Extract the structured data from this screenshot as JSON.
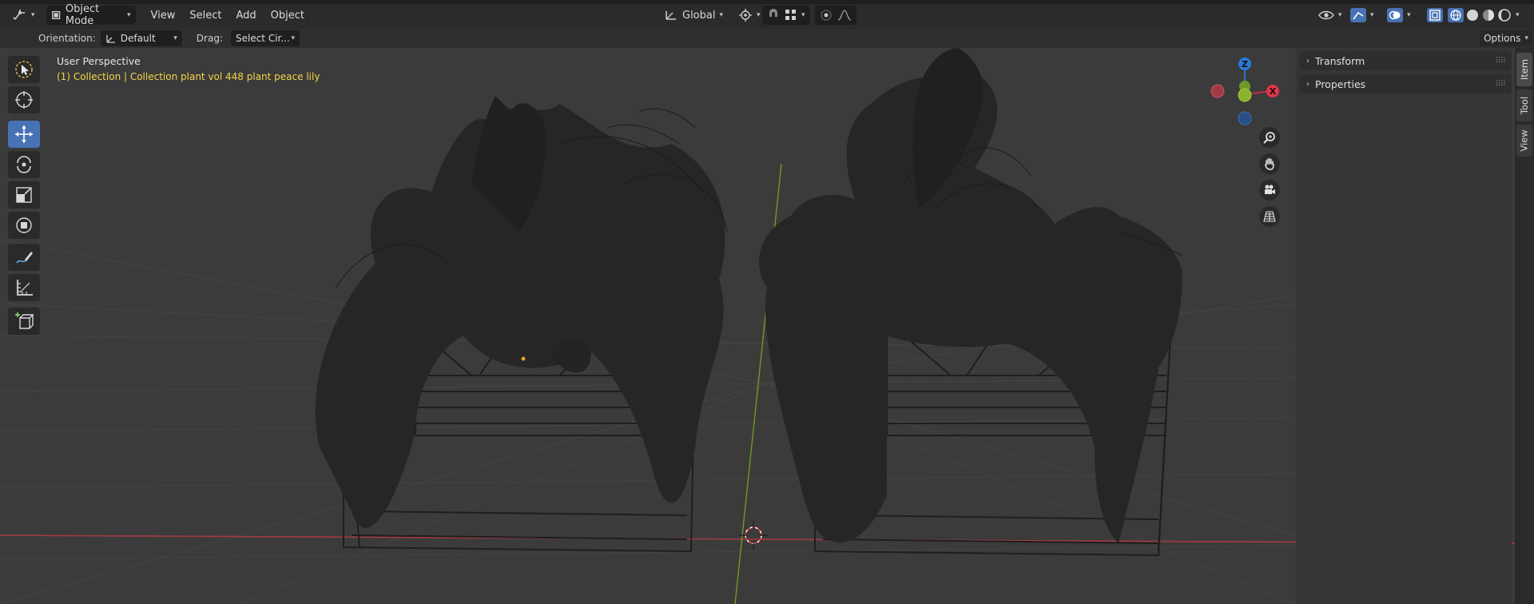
{
  "header": {
    "mode": "Object Mode",
    "menus": [
      "View",
      "Select",
      "Add",
      "Object"
    ],
    "transform_orientation": "Global"
  },
  "toolbar": {
    "orientation_label": "Orientation:",
    "orientation_value": "Default",
    "drag_label": "Drag:",
    "drag_value": "Select Cir...",
    "options_label": "Options"
  },
  "viewport": {
    "perspective": "User Perspective",
    "collection": "(1) Collection | Collection plant vol 448 plant peace lily"
  },
  "gizmo": {
    "z_label": "Z",
    "x_label": "X"
  },
  "sidebar": {
    "panels": [
      "Transform",
      "Properties"
    ],
    "tabs": [
      "Item",
      "Tool",
      "View"
    ]
  },
  "colors": {
    "accent": "#4772b3",
    "axis_x": "#ff3352",
    "axis_y": "#8bdc00",
    "axis_z": "#2890ff",
    "highlight_text": "#f2d54a"
  }
}
